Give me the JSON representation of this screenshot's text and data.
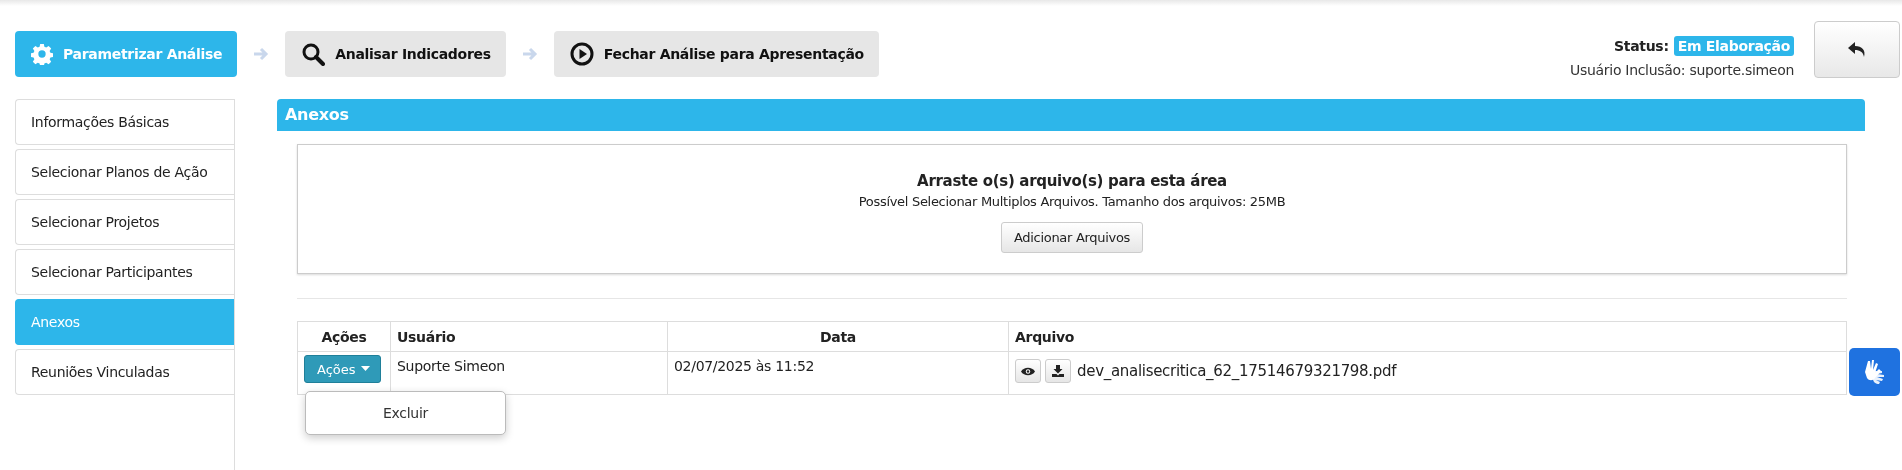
{
  "steps": [
    {
      "label": "Parametrizar Análise",
      "kind": "gear",
      "selected": true
    },
    {
      "label": "Analisar Indicadores",
      "kind": "search",
      "selected": false
    },
    {
      "label": "Fechar Análise para Apresentação",
      "kind": "play",
      "selected": false
    }
  ],
  "status": {
    "label": "Status:",
    "value": "Em Elaboração",
    "user_line": "Usuário Inclusão: suporte.simeon"
  },
  "sidebar": {
    "items": [
      {
        "label": "Informações Básicas",
        "selected": false
      },
      {
        "label": "Selecionar Planos de Ação",
        "selected": false
      },
      {
        "label": "Selecionar Projetos",
        "selected": false
      },
      {
        "label": "Selecionar Participantes",
        "selected": false
      },
      {
        "label": "Anexos",
        "selected": true
      },
      {
        "label": "Reuniões Vinculadas",
        "selected": false
      }
    ]
  },
  "panel": {
    "title": "Anexos",
    "dropzone": {
      "title": "Arraste o(s) arquivo(s) para esta área",
      "subtitle": "Possível Selecionar Multiplos Arquivos. Tamanho dos arquivos: 25MB",
      "button": "Adicionar Arquivos"
    },
    "table": {
      "columns": [
        "Ações",
        "Usuário",
        "Data",
        "Arquivo"
      ],
      "rows": [
        {
          "actions": "Ações",
          "user": "Suporte Simeon",
          "date": "02/07/2025 às 11:52",
          "file": "dev_analisecritica_62_17514679321798.pdf"
        }
      ]
    },
    "dropdown_menu": {
      "items": [
        "Excluir"
      ]
    }
  }
}
